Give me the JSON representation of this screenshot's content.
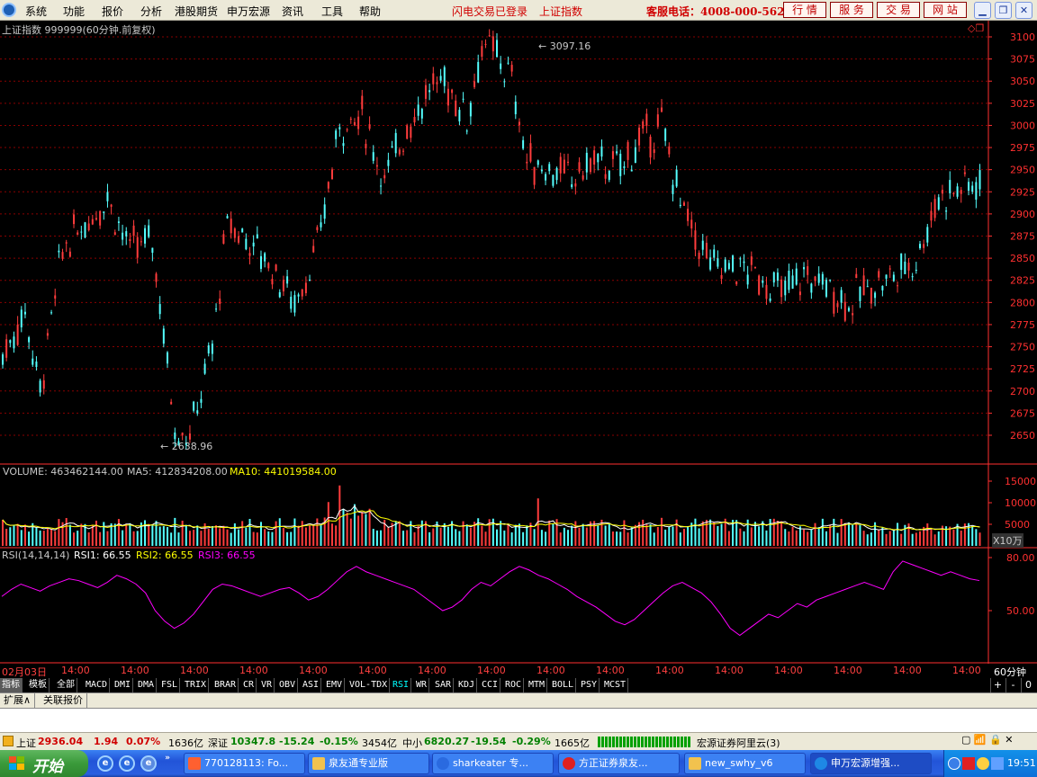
{
  "menubar": {
    "items": [
      "系统",
      "功能",
      "报价",
      "分析",
      "港股期货",
      "申万宏源",
      "资讯",
      "工具",
      "帮助"
    ],
    "notice_login": "闪电交易已登录",
    "notice_index": "上证指数",
    "service_phone": "客服电话：4008-000-562",
    "buttons": [
      "行 情",
      "服 务",
      "交 易",
      "网 站"
    ],
    "window_controls": [
      "minimize-icon",
      "restore-icon",
      "close-icon"
    ]
  },
  "chart": {
    "title": "上证指数 999999(60分钟.前复权)",
    "price_ticks": [
      "3100",
      "3075",
      "3050",
      "3025",
      "3000",
      "2975",
      "2950",
      "2925",
      "2900",
      "2875",
      "2850",
      "2825",
      "2800",
      "2775",
      "2750",
      "2725",
      "2700",
      "2675",
      "2650"
    ],
    "high_label": "3097.16",
    "low_label": "2638.96",
    "volume_label": "VOLUME: 463462144.00",
    "ma5_label": "MA5: 412834208.00",
    "ma10_label": "MA10: 441019584.00",
    "volume_ticks": [
      "15000",
      "10000",
      "5000"
    ],
    "volume_unit": "X10万",
    "rsi_label": "RSI(14,14,14)",
    "rsi1_label": "RSI1: 66.55",
    "rsi2_label": "RSI2: 66.55",
    "rsi3_label": "RSI3: 66.55",
    "rsi_ticks": [
      "80.00",
      "50.00"
    ],
    "time_labels": [
      "02月03日",
      "14:00",
      "14:00",
      "14:00",
      "14:00",
      "14:00",
      "14:00",
      "14:00",
      "14:00",
      "14:00",
      "14:00",
      "14:00",
      "14:00",
      "14:00",
      "14:00",
      "14:00",
      "14:00",
      "14:00"
    ],
    "period": "60分钟",
    "colors": {
      "up": "#ff3c3c",
      "down": "#54ffff",
      "ma5": "#ffffff",
      "ma10": "#ffff00",
      "rsi": "#ff00ff",
      "axis": "#ff3030"
    }
  },
  "chart_data": {
    "type": "line",
    "title": "上证指数 999999(60分钟.前复权)",
    "xlabel": "",
    "ylabel": "",
    "ylim": [
      2630,
      3110
    ],
    "annotations": [
      {
        "label": "3097.16"
      },
      {
        "label": "2638.96"
      }
    ],
    "x": [
      "02月03日",
      "",
      "",
      "",
      "",
      "",
      "",
      "",
      "",
      "",
      "",
      "",
      "",
      "",
      "",
      "",
      "",
      "",
      "",
      "",
      "",
      "",
      "",
      "",
      "",
      "",
      "",
      "",
      "",
      "",
      "",
      "",
      "",
      "",
      "",
      "",
      "",
      "",
      "",
      "",
      "",
      "",
      "",
      "",
      "",
      "",
      "",
      "",
      "",
      "",
      "",
      "",
      "",
      "",
      "",
      "",
      "",
      "",
      "",
      "",
      "",
      "",
      "",
      "",
      "",
      "",
      "",
      "",
      "",
      "",
      "",
      "",
      "",
      "",
      "",
      "",
      "",
      "",
      "",
      "",
      "",
      "",
      "",
      "",
      "",
      "",
      "",
      "",
      "",
      "",
      "",
      "",
      "",
      "",
      ""
    ],
    "series": [
      {
        "name": "RSI1",
        "values": [
          58,
          62,
          65,
          63,
          61,
          64,
          66,
          68,
          67,
          65,
          63,
          66,
          70,
          68,
          65,
          60,
          50,
          44,
          40,
          43,
          48,
          55,
          62,
          65,
          64,
          62,
          60,
          58,
          60,
          62,
          63,
          60,
          56,
          58,
          62,
          67,
          72,
          75,
          72,
          70,
          68,
          66,
          64,
          62,
          58,
          54,
          50,
          52,
          56,
          62,
          66,
          64,
          68,
          72,
          75,
          73,
          70,
          68,
          65,
          62,
          58,
          55,
          52,
          48,
          44,
          42,
          45,
          50,
          55,
          60,
          64,
          66,
          63,
          60,
          55,
          48,
          40,
          36,
          40,
          44,
          48,
          46,
          50,
          54,
          52,
          56,
          58,
          60,
          62,
          64,
          66,
          64,
          62,
          72,
          78,
          76,
          74,
          72,
          70,
          72,
          70,
          68,
          67
        ]
      }
    ]
  },
  "tabs": [
    "指标",
    "模板",
    "全部",
    "MACD",
    "DMI",
    "DMA",
    "FSL",
    "TRIX",
    "BRAR",
    "CR",
    "VR",
    "OBV",
    "ASI",
    "EMV",
    "VOL-TDX",
    "RSI",
    "WR",
    "SAR",
    "KDJ",
    "CCI",
    "ROC",
    "MTM",
    "BOLL",
    "PSY",
    "MCST"
  ],
  "tab_controls": [
    "+",
    "-",
    "0"
  ],
  "ext_tabs": [
    "扩展∧",
    "关联报价"
  ],
  "status": {
    "sh_name": "上证",
    "sh_price": "2936.04",
    "sh_chg": "1.94",
    "sh_pct": "0.07%",
    "sh_amt": "1636亿",
    "sz_name": "深证",
    "sz_price": "10347.8",
    "sz_chg": "-15.24",
    "sz_pct": "-0.15%",
    "sz_amt": "3454亿",
    "zx_name": "中小",
    "zx_price": "6820.27",
    "zx_chg": "-19.54",
    "zx_pct": "-0.29%",
    "zx_amt": "1665亿",
    "broker": "宏源证券阿里云(3)"
  },
  "taskbar": {
    "start_label": "开始",
    "tasks": [
      "770128113: Fo...",
      "泉友通专业版",
      "sharkeater 专...",
      "方正证券泉友...",
      "new_swhy_v6",
      "申万宏源增强..."
    ],
    "clock": "19:51"
  }
}
